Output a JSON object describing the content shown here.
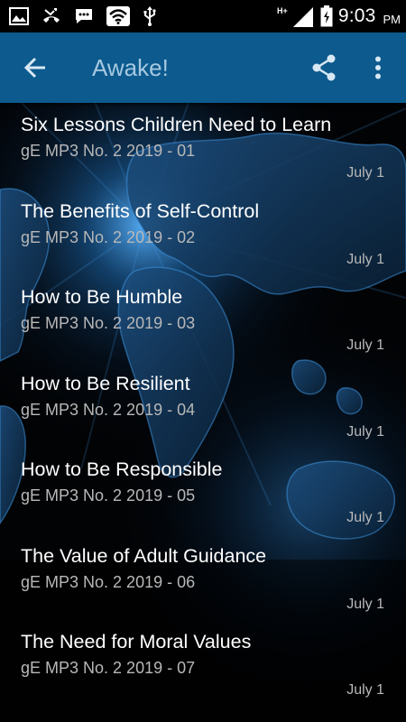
{
  "status_bar": {
    "time": "9:03",
    "ampm": "PM",
    "network_label": "H+",
    "left_icons": [
      "image-icon",
      "missed-call-icon",
      "message-icon",
      "wifi-icon",
      "usb-icon"
    ],
    "right_icons": [
      "signal-icon",
      "battery-charging-icon"
    ]
  },
  "app_bar": {
    "title": "Awake!",
    "color": "#0c5a8e",
    "title_color": "#a6c8e0",
    "icons": [
      "back-arrow-icon",
      "share-icon",
      "more-vert-icon"
    ]
  },
  "list": {
    "items": [
      {
        "title": "Six Lessons Children Need to Learn",
        "subtitle": "gE MP3 No. 2 2019 - 01",
        "date": "July 1"
      },
      {
        "title": "The Benefits of Self-Control",
        "subtitle": "gE MP3 No. 2 2019 - 02",
        "date": "July 1"
      },
      {
        "title": "How to Be Humble",
        "subtitle": "gE MP3 No. 2 2019 - 03",
        "date": "July 1"
      },
      {
        "title": "How to Be Resilient",
        "subtitle": "gE MP3 No. 2 2019 - 04",
        "date": "July 1"
      },
      {
        "title": "How to Be Responsible",
        "subtitle": "gE MP3 No. 2 2019 - 05",
        "date": "July 1"
      },
      {
        "title": "The Value of Adult Guidance",
        "subtitle": "gE MP3 No. 2 2019 - 06",
        "date": "July 1"
      },
      {
        "title": "The Need for Moral Values",
        "subtitle": "gE MP3 No. 2 2019 - 07",
        "date": "July 1"
      }
    ]
  }
}
